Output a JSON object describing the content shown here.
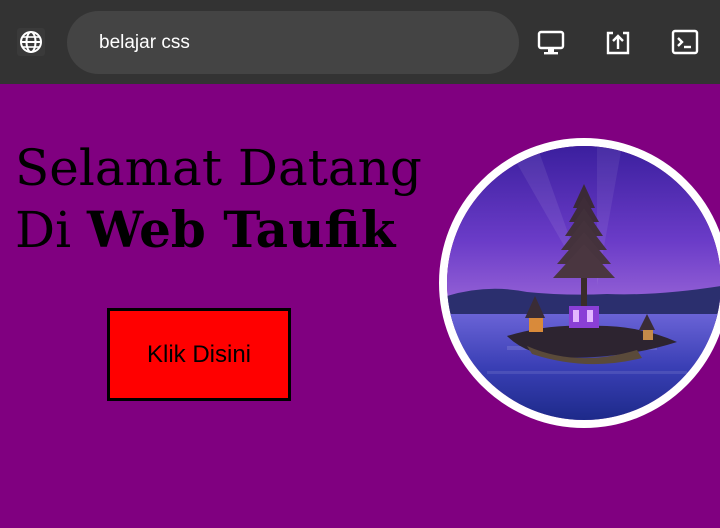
{
  "browser": {
    "url_text": "belajar css",
    "icons": [
      "globe-icon",
      "desktop-icon",
      "share-upload-icon",
      "terminal-icon"
    ]
  },
  "page": {
    "headline_line1": "Selamat Datang",
    "headline_di": "Di",
    "headline_strong": "Web Taufik",
    "button_label": "Klik Disini"
  },
  "colors": {
    "page_background": "#800080",
    "button_background": "#ff0000",
    "toolbar_background": "#333333"
  }
}
